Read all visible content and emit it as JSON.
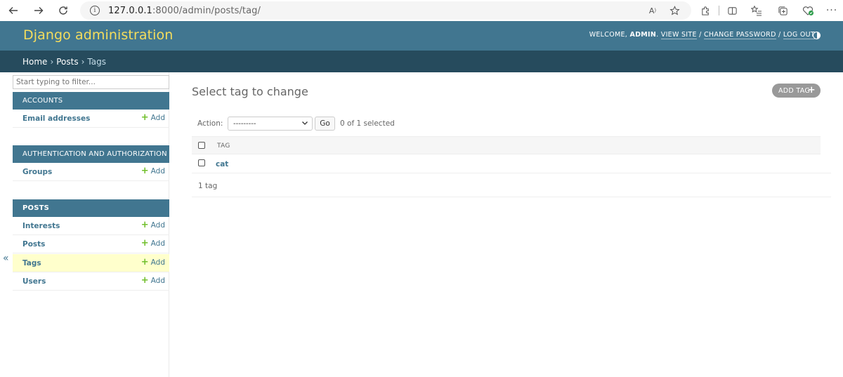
{
  "browser": {
    "url_host": "127.0.0.1",
    "url_path": ":8000/admin/posts/tag/"
  },
  "header": {
    "branding": "Django administration",
    "welcome": "WELCOME,",
    "user": "ADMIN",
    "view_site": "VIEW SITE",
    "change_password": "CHANGE PASSWORD",
    "log_out": "LOG OUT"
  },
  "breadcrumbs": {
    "home": "Home",
    "posts": "Posts",
    "current": "Tags",
    "sep": "›"
  },
  "sidebar": {
    "filter_placeholder": "Start typing to filter...",
    "collapse": "«",
    "add_label": "Add",
    "modules": [
      {
        "caption": "ACCOUNTS",
        "models": [
          "Email addresses"
        ]
      },
      {
        "caption": "AUTHENTICATION AND AUTHORIZATION",
        "models": [
          "Groups"
        ]
      },
      {
        "caption": "POSTS",
        "models": [
          "Interests",
          "Posts",
          "Tags",
          "Users"
        ]
      }
    ]
  },
  "content": {
    "title": "Select tag to change",
    "add_button": "ADD TAG",
    "action_label": "Action:",
    "action_value": "---------",
    "go": "Go",
    "selected_counter": "0 of 1 selected",
    "column_header": "TAG",
    "rows": [
      "cat"
    ],
    "paginator": "1 tag"
  },
  "colors": {
    "primary": "#417690",
    "secondary": "#264b5d",
    "accent": "#f5dd5d",
    "add_green": "#70bf2b",
    "selected_row": "#ffffcc"
  }
}
